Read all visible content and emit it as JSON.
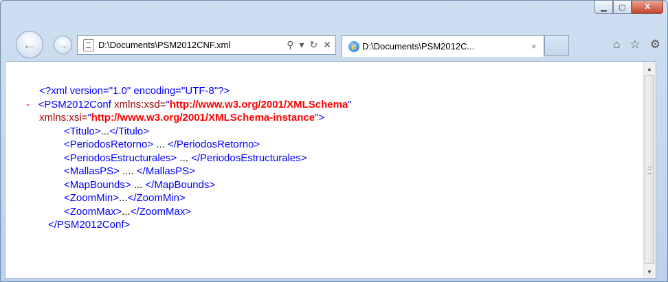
{
  "window": {
    "minimize_glyph": "▁",
    "maximize_glyph": "▢",
    "close_glyph": "X"
  },
  "nav": {
    "address_url": "D:\\Documents\\PSM2012CNF.xml",
    "address_tools": [
      "⚲",
      "▾",
      "↻",
      "✕"
    ],
    "tab_title": "D:\\Documents\\PSM2012C...",
    "tab_close": "×",
    "right_icons": [
      "⌂",
      "☆",
      "⚙"
    ]
  },
  "xml": {
    "decl": "<?xml version=\"1.0\" encoding=\"UTF-8\"?>",
    "collapse": "-",
    "root_open": "<PSM2012Conf",
    "attr1_name": " xmlns:xsd=",
    "attr1_q1": "\"",
    "attr1_value": "http://www.w3.org/2001/XMLSchema",
    "attr1_q2": "\"",
    "attr2_name": "xmlns:xsi=",
    "attr2_q1": "\"",
    "attr2_value": "http://www.w3.org/2001/XMLSchema-instance",
    "attr2_q2": "\">",
    "children": [
      {
        "open": "<Titulo>",
        "text": "...",
        "close": "</Titulo>"
      },
      {
        "open": "<PeriodosRetorno>",
        "text": " ... ",
        "close": "</PeriodosRetorno>"
      },
      {
        "open": "<PeriodosEstructurales>",
        "text": " ... ",
        "close": "</PeriodosEstructurales>"
      },
      {
        "open": "<MallasPS>",
        "text": " .... ",
        "close": "</MallasPS>"
      },
      {
        "open": "<MapBounds>",
        "text": " ... ",
        "close": "</MapBounds>"
      },
      {
        "open": "<ZoomMin>",
        "text": "...",
        "close": "</ZoomMin>"
      },
      {
        "open": "<ZoomMax>",
        "text": "...",
        "close": "</ZoomMax>"
      }
    ],
    "root_close": "</PSM2012Conf>"
  },
  "scrollbar": {
    "up": "▲",
    "down": "▼"
  }
}
